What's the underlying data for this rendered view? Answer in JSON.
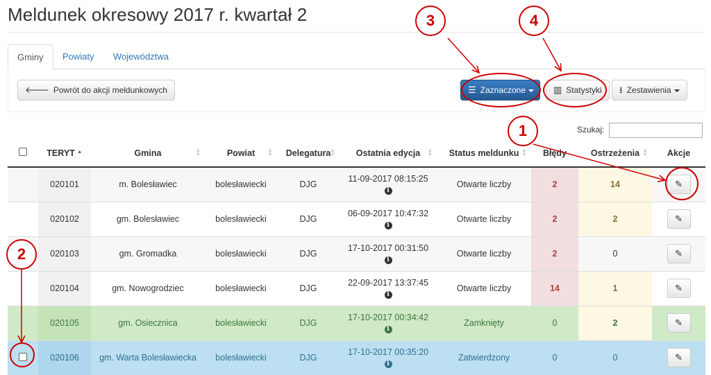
{
  "page": {
    "title": "Meldunek okresowy 2017 r. kwartał 2"
  },
  "tabs": [
    {
      "label": "Gminy",
      "active": true
    },
    {
      "label": "Powiaty",
      "active": false
    },
    {
      "label": "Województwa",
      "active": false
    }
  ],
  "toolbar": {
    "back_label": "Powrót do akcji meldunkowych",
    "selected_label": "Zaznaczone",
    "stats_label": "Statystyki",
    "report_label": "Zestawienia"
  },
  "search": {
    "label": "Szukaj:",
    "value": ""
  },
  "table": {
    "headers": [
      "TERYT",
      "Gmina",
      "Powiat",
      "Delegatura",
      "Ostatnia edycja",
      "Status meldunku",
      "Błędy",
      "Ostrzeżenia",
      "Akcje"
    ],
    "rows": [
      {
        "teryt": "020101",
        "gmina": "m. Bolesławiec",
        "powiat": "bolesławiecki",
        "delegatura": "DJG",
        "date": "11-09-2017 08:15:25",
        "status": "Otwarte liczby",
        "errors": "2",
        "warnings": "14",
        "checkbox": false
      },
      {
        "teryt": "020102",
        "gmina": "gm. Bolesławiec",
        "powiat": "bolesławiecki",
        "delegatura": "DJG",
        "date": "06-09-2017 10:47:32",
        "status": "Otwarte liczby",
        "errors": "2",
        "warnings": "2",
        "checkbox": false
      },
      {
        "teryt": "020103",
        "gmina": "gm. Gromadka",
        "powiat": "bolesławiecki",
        "delegatura": "DJG",
        "date": "17-10-2017 00:31:50",
        "status": "Otwarte liczby",
        "errors": "2",
        "warnings": "0",
        "checkbox": false
      },
      {
        "teryt": "020104",
        "gmina": "gm. Nowogrodziec",
        "powiat": "bolesławiecki",
        "delegatura": "DJG",
        "date": "22-09-2017 13:37:45",
        "status": "Otwarte liczby",
        "errors": "14",
        "warnings": "1",
        "checkbox": false
      },
      {
        "teryt": "020105",
        "gmina": "gm. Osiecznica",
        "powiat": "bolesławiecki",
        "delegatura": "DJG",
        "date": "17-10-2017 00:34:42",
        "status": "Zamknięty",
        "errors": "0",
        "warnings": "2",
        "checkbox": false
      },
      {
        "teryt": "020106",
        "gmina": "gm. Warta Bolesławiecka",
        "powiat": "bolesławiecki",
        "delegatura": "DJG",
        "date": "17-10-2017 00:35:20",
        "status": "Zatwierdzony",
        "errors": "0",
        "warnings": "0",
        "checkbox": true
      }
    ]
  },
  "annotations": [
    "1",
    "2",
    "3",
    "4"
  ],
  "colors": {
    "accent": "#337ab7",
    "primary_button": "#2b6cb0",
    "annotation": "#cc0000",
    "success_row": "#d0e9c6",
    "info_row": "#bcdff1",
    "error_cell": "#f2dede",
    "warning_cell": "#fcf8e3"
  },
  "icons": {
    "back": "arrow-left-icon",
    "selected": "list-icon",
    "stats": "bar-chart-icon",
    "report": "download-icon",
    "edit": "pencil-icon",
    "info": "info-icon"
  }
}
